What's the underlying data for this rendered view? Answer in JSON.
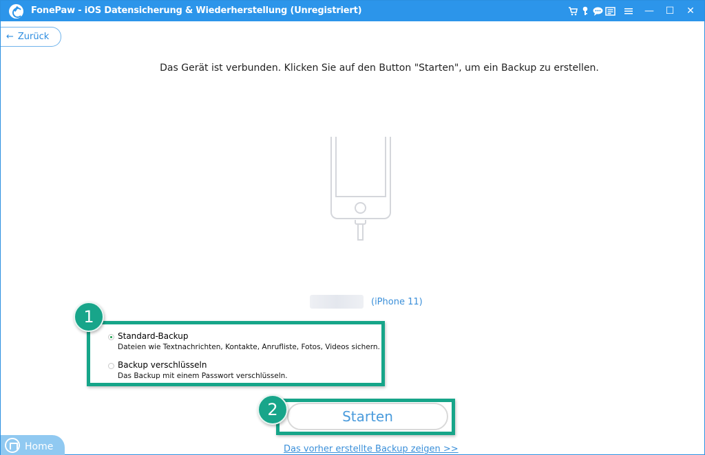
{
  "window": {
    "title": "FonePaw - iOS Datensicherung & Wiederherstellung (Unregistriert)",
    "titlebar_icons": [
      "cart-icon",
      "key-icon",
      "chat-icon",
      "feedback-icon",
      "menu-icon",
      "minimize-icon",
      "maximize-icon",
      "close-icon"
    ],
    "minimize_glyph": "—",
    "maximize_glyph": "☐",
    "close_glyph": "✕"
  },
  "nav": {
    "back_label": "Zurück",
    "back_arrow": "←",
    "home_label": "Home"
  },
  "main": {
    "instruction": "Das Gerät ist verbunden. Klicken Sie auf den Button \"Starten\", um ein Backup zu erstellen.",
    "device_name": "(iPhone 11)"
  },
  "options": {
    "badge": "1",
    "items": [
      {
        "title": "Standard-Backup",
        "description": "Dateien wie Textnachrichten, Kontakte, Anrufliste, Fotos, Videos sichern.",
        "selected": true
      },
      {
        "title": "Backup verschlüsseln",
        "description": "Das Backup mit einem Passwort verschlüsseln.",
        "selected": false
      }
    ]
  },
  "start": {
    "badge": "2",
    "label": "Starten"
  },
  "footer": {
    "previous_backup_link": "Das vorher erstellte Backup zeigen >>"
  },
  "colors": {
    "titlebar": "#2c95ea",
    "highlight": "#16a589",
    "link": "#3a8fd9"
  }
}
